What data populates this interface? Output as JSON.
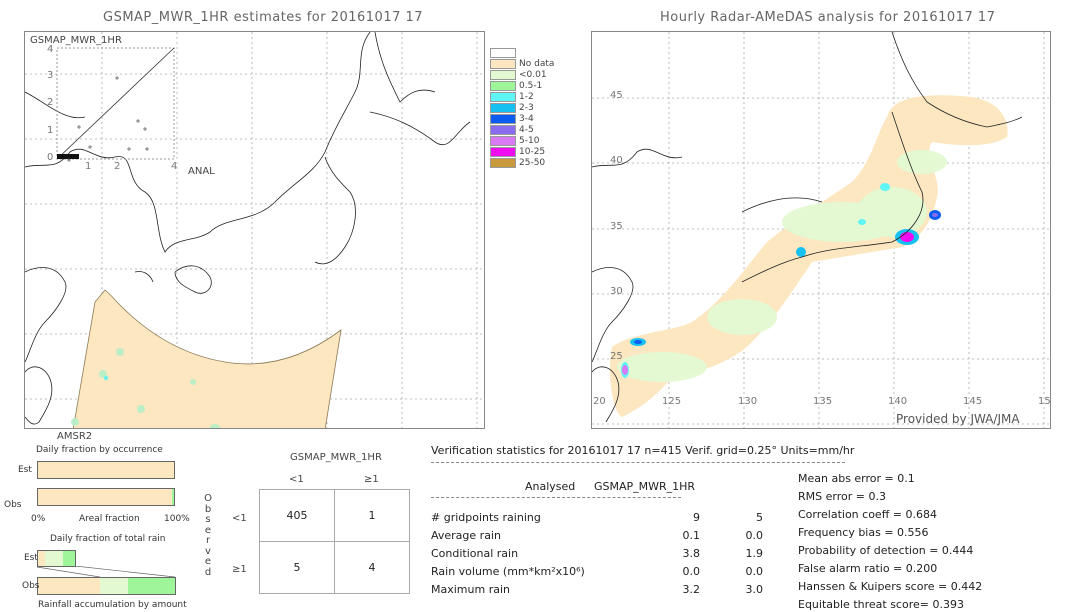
{
  "left_panel": {
    "title": "GSMAP_MWR_1HR estimates for 20161017 17",
    "inset_label": "GSMAP_MWR_1HR",
    "inset_y_ticks": [
      "4",
      "3",
      "2",
      "1",
      "0"
    ],
    "inset_x_ticks": [
      "1",
      "2",
      "4"
    ],
    "inset_x_label": "ANAL",
    "sensor_label": "AMSR2"
  },
  "right_panel": {
    "title": "Hourly Radar-AMeDAS analysis for 20161017 17",
    "lat_ticks": [
      "45",
      "40",
      "35",
      "30",
      "25",
      "20"
    ],
    "lon_ticks": [
      "125",
      "130",
      "135",
      "140",
      "145",
      "15"
    ],
    "bottom_lat_label": "20",
    "credit": "Provided by JWA/JMA"
  },
  "legend": {
    "items": [
      {
        "label": "",
        "color": "#ffffff"
      },
      {
        "label": "No data",
        "color": "#fce7c0"
      },
      {
        "label": "<0.01",
        "color": "#e3f9d2"
      },
      {
        "label": "0.5-1",
        "color": "#9ef59a"
      },
      {
        "label": "1-2",
        "color": "#5ff5f5"
      },
      {
        "label": "2-3",
        "color": "#16c0f0"
      },
      {
        "label": "3-4",
        "color": "#0a5cf0"
      },
      {
        "label": "4-5",
        "color": "#8a6cf0"
      },
      {
        "label": "5-10",
        "color": "#d97af5"
      },
      {
        "label": "10-25",
        "color": "#f00cf0"
      },
      {
        "label": "25-50",
        "color": "#c89a3c"
      }
    ]
  },
  "fraction_charts": {
    "occurrence_title": "Daily fraction by occurrence",
    "est_label": "Est",
    "obs_label": "Obs",
    "axis_left": "0%",
    "axis_mid": "Areal fraction",
    "axis_right": "100%",
    "total_rain_title": "Daily fraction of total rain",
    "accumulation_label": "Rainfall accumulation by amount"
  },
  "contingency": {
    "title": "GSMAP_MWR_1HR",
    "col_headers": [
      "<1",
      "≥1"
    ],
    "row_headers": [
      "<1",
      "≥1"
    ],
    "side_label": [
      "O",
      "b",
      "s",
      "e",
      "r",
      "v",
      "e",
      "d"
    ],
    "cells": [
      [
        "405",
        "1"
      ],
      [
        "5",
        "4"
      ]
    ]
  },
  "verification": {
    "header": "Verification statistics for 20161017 17   n=415   Verif. grid=0.25°   Units=mm/hr",
    "col_analysed": "Analysed",
    "col_model": "GSMAP_MWR_1HR",
    "rows": [
      {
        "label": "# gridpoints raining",
        "analysed": "9",
        "model": "5"
      },
      {
        "label": "Average rain",
        "analysed": "0.1",
        "model": "0.0"
      },
      {
        "label": "Conditional rain",
        "analysed": "3.8",
        "model": "1.9"
      },
      {
        "label": "Rain volume (mm*km²x10⁶)",
        "analysed": "0.0",
        "model": "0.0"
      },
      {
        "label": "Maximum rain",
        "analysed": "3.2",
        "model": "3.0"
      }
    ],
    "scores": [
      "Mean abs error = 0.1",
      "RMS error = 0.3",
      "Correlation coeff = 0.684",
      "Frequency bias = 0.556",
      "Probability of detection = 0.444",
      "False alarm ratio = 0.200",
      "Hanssen & Kuipers score = 0.442",
      "Equitable threat score= 0.393"
    ]
  }
}
